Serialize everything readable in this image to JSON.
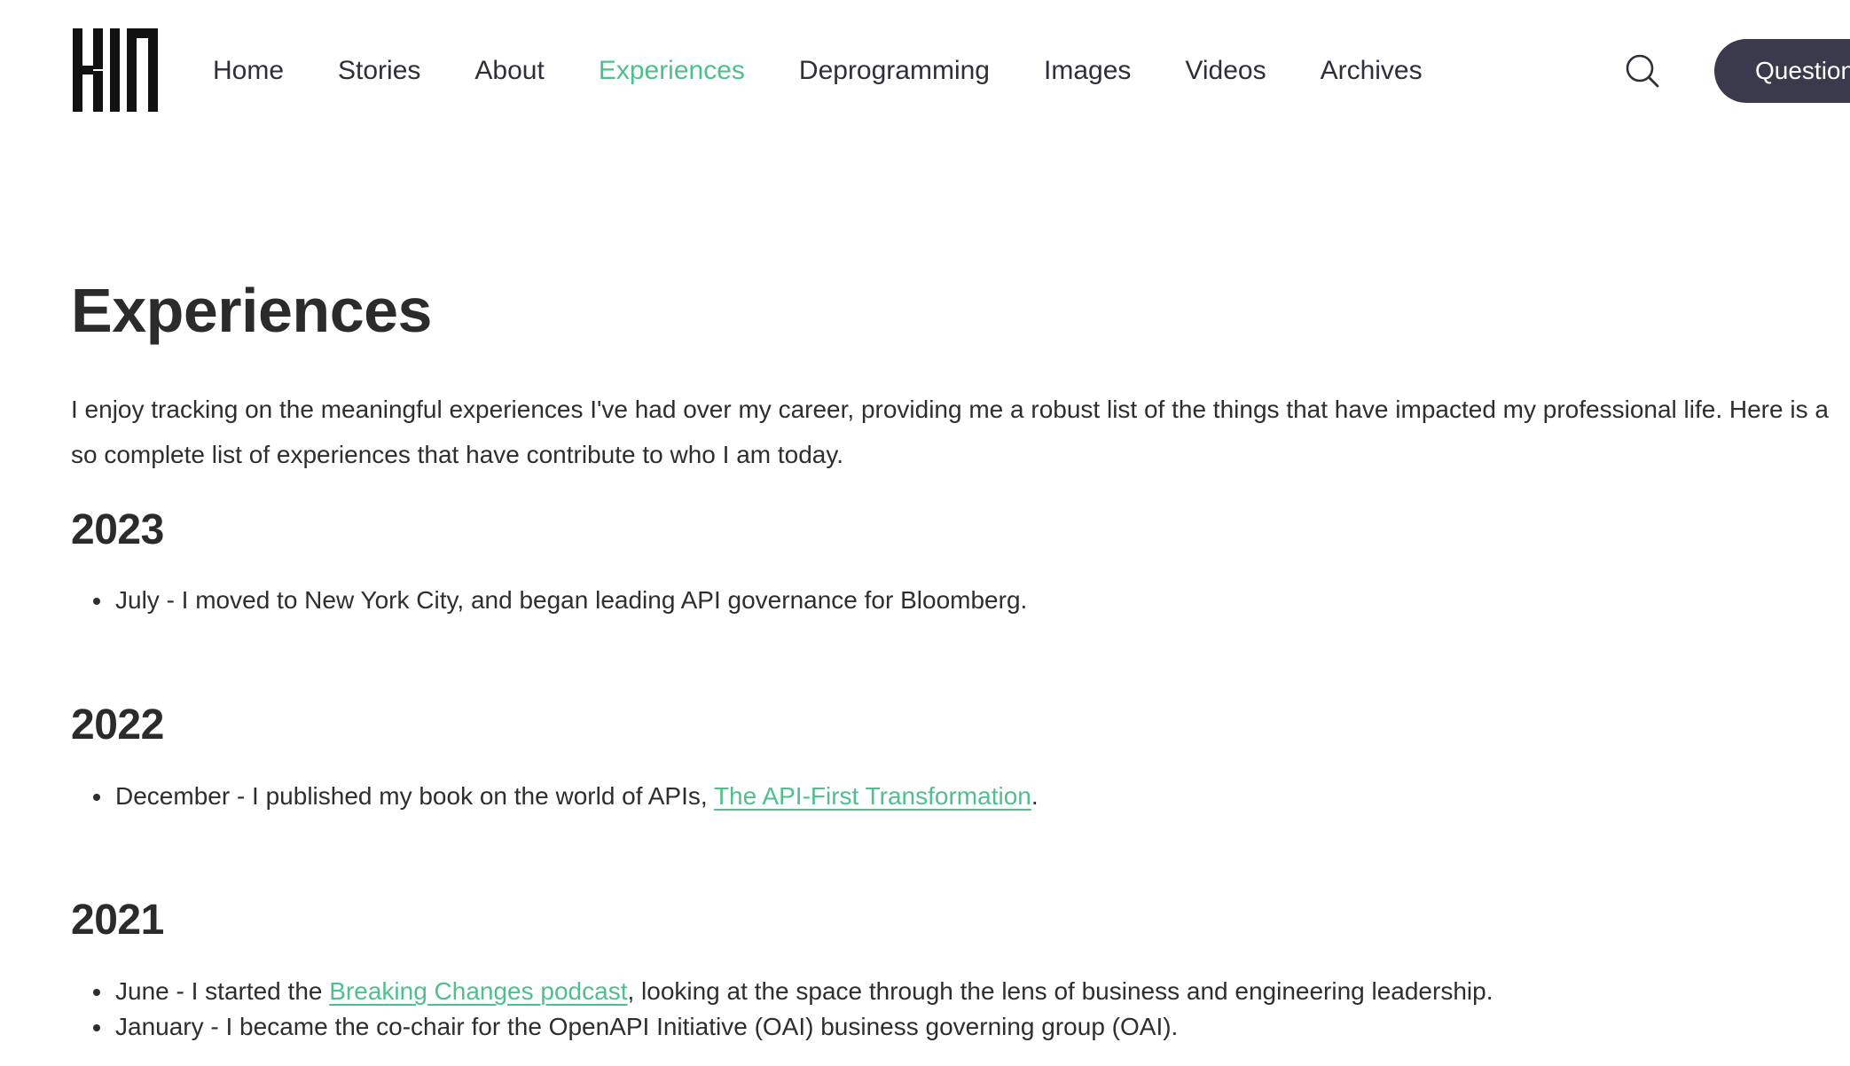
{
  "header": {
    "logo_text": "KIN",
    "nav": [
      {
        "label": "Home",
        "active": false
      },
      {
        "label": "Stories",
        "active": false
      },
      {
        "label": "About",
        "active": false
      },
      {
        "label": "Experiences",
        "active": true
      },
      {
        "label": "Deprogramming",
        "active": false
      },
      {
        "label": "Images",
        "active": false
      },
      {
        "label": "Videos",
        "active": false
      },
      {
        "label": "Archives",
        "active": false
      }
    ],
    "search_icon": "search-icon",
    "question_button": "Questions"
  },
  "main": {
    "title": "Experiences",
    "intro": "I enjoy tracking on the meaningful experiences I've had over my career, providing me a robust list of the things that have impacted my professional life. Here is a",
    "intro_line2": "so complete list of experiences that have contribute to who I am today.",
    "sections": [
      {
        "year": "2023",
        "items": [
          {
            "text": "July - I moved to New York City, and began leading API governance for Bloomberg."
          }
        ]
      },
      {
        "year": "2022",
        "items": [
          {
            "before": "December - I published my book on the world of APIs, ",
            "link": "The API-First Transformation",
            "after": "."
          }
        ]
      },
      {
        "year": "2021",
        "items": [
          {
            "before": "June - I started the ",
            "link": "Breaking Changes podcast",
            "after": ", looking at the space through the lens of business and engineering leadership."
          },
          {
            "text": "January - I became the co-chair for the OpenAPI Initiative (OAI) business governing group (OAI)."
          }
        ]
      }
    ]
  },
  "colors": {
    "accent": "#4fbf8c",
    "text": "#2e2e2e",
    "button_bg": "#3b3a4c"
  }
}
